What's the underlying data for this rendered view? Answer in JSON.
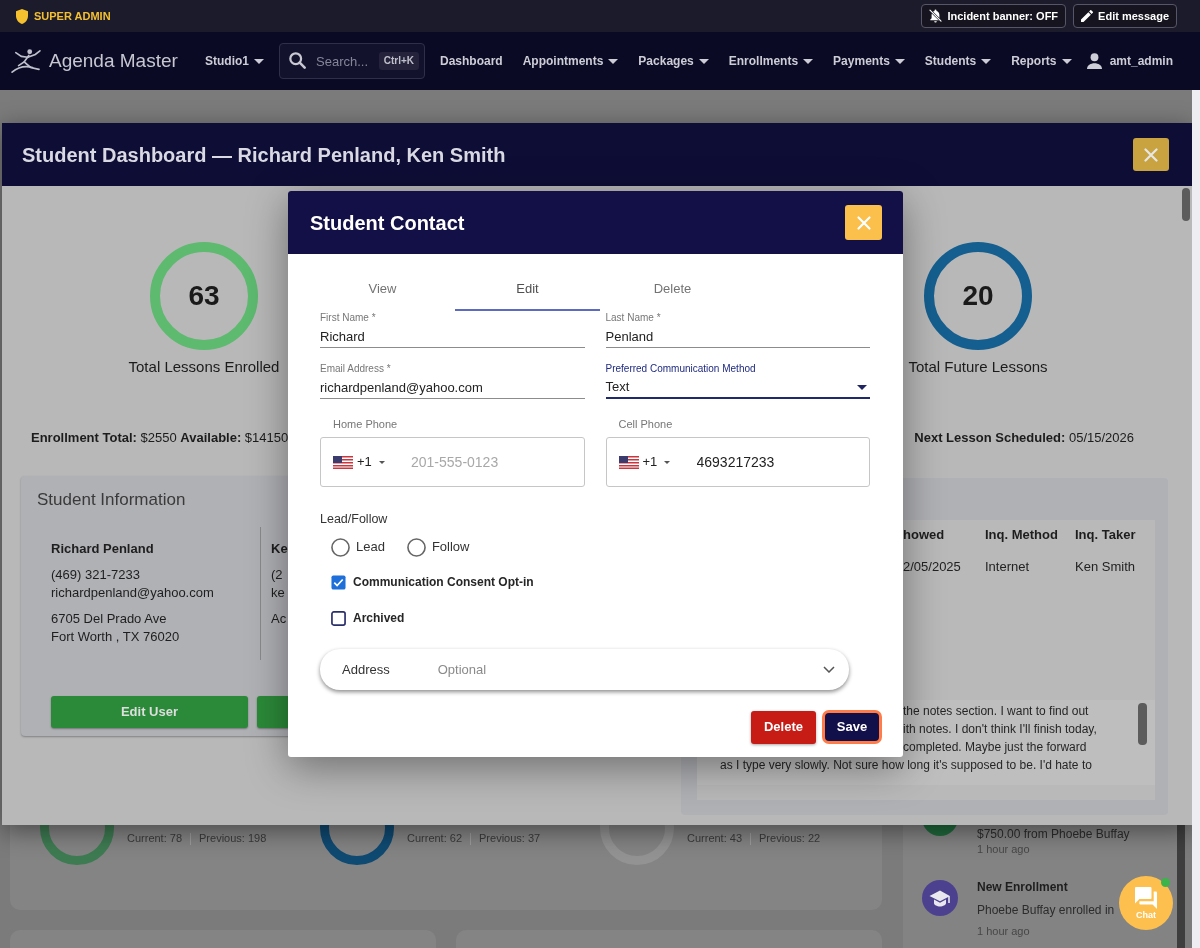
{
  "admin_bar": {
    "role": "SUPER ADMIN",
    "buttons": [
      {
        "kind": "incident",
        "label": "Incident banner: OFF"
      },
      {
        "kind": "edit",
        "label": "Edit message"
      }
    ]
  },
  "nav": {
    "brand": "Agenda Master",
    "studio": {
      "label": "Studio1",
      "dropdown": true
    },
    "search": {
      "placeholder": "Search...",
      "shortcut": "Ctrl+K"
    },
    "items": [
      {
        "label": "Dashboard",
        "dropdown": false
      },
      {
        "label": "Appointments",
        "dropdown": true
      },
      {
        "label": "Packages",
        "dropdown": true
      },
      {
        "label": "Enrollments",
        "dropdown": true
      },
      {
        "label": "Payments",
        "dropdown": true
      },
      {
        "label": "Students",
        "dropdown": true
      },
      {
        "label": "Reports",
        "dropdown": true
      }
    ],
    "user": "amt_admin"
  },
  "background_page": {
    "stats": [
      {
        "current": "Current: 78",
        "previous": "Previous: 198",
        "color": "#3e7b52"
      },
      {
        "current": "Current: 62",
        "previous": "Previous: 37",
        "color": "#0f4a72"
      },
      {
        "current": "Current: 43",
        "previous": "Previous: 22",
        "color": "#939393"
      }
    ],
    "activity": [
      {
        "kind": "payment",
        "text": "$750.00 from Phoebe Buffay",
        "time": "1 hour ago"
      },
      {
        "kind": "enrollment",
        "title": "New Enrollment",
        "text": "Phoebe Buffay enrolled in",
        "time": "1 hour ago"
      }
    ]
  },
  "dashboard_dialog": {
    "title": "Student Dashboard — Richard Penland, Ken Smith",
    "stats": [
      {
        "value": "63",
        "label": "Total Lessons Enrolled",
        "color": "#5dba6f"
      },
      {
        "value": "20",
        "label": "Total Future Lessons",
        "color": "#145f8f"
      }
    ],
    "enrollment_summary": "**Enrollment Total:** $2550 **Available:** $14150",
    "next_lesson": "**Next Lesson Scheduled:** 05/15/2026",
    "student_information": {
      "title": "Student Information",
      "students": [
        {
          "name": "Richard Penland",
          "phone": "(469) 321-7233",
          "email": "richardpenland@yahoo.com",
          "address_lines": [
            "6705 Del Prado Ave",
            "Fort Worth , TX 76020"
          ]
        },
        {
          "name": "Ke",
          "phone": "(2",
          "email": "ke",
          "address_lines": [
            "Ac"
          ]
        }
      ],
      "buttons": [
        {
          "kind": "labeled",
          "label": "Edit User"
        },
        {
          "kind": "covered"
        }
      ]
    },
    "inquiry_table": {
      "columns": [
        "howed",
        "Inq. Method",
        "Inq. Taker"
      ],
      "rows": [
        [
          "2/05/2025",
          "Internet",
          "Ken Smith"
        ]
      ]
    },
    "notes": [
      "the notes section. I want to find out",
      "ith notes. I don't think I'll finish today,",
      "completed. Maybe just the forward",
      "as I type very slowly. Not sure how long it's supposed to be. I'd hate to"
    ]
  },
  "contact_dialog": {
    "title": "Student Contact",
    "tabs": [
      {
        "label": "View",
        "selected": false
      },
      {
        "label": "Edit",
        "selected": true
      },
      {
        "label": "Delete",
        "selected": false
      }
    ],
    "fields": [
      {
        "kind": "text",
        "label": "First Name *",
        "value": "Richard",
        "focused": false
      },
      {
        "kind": "text",
        "label": "Last Name *",
        "value": "Penland",
        "focused": false
      },
      {
        "kind": "text",
        "label": "Email Address *",
        "value": "richardpenland@yahoo.com",
        "focused": false
      },
      {
        "kind": "select",
        "label": "Preferred Communication Method",
        "value": "Text",
        "focused": true
      }
    ],
    "phones": [
      {
        "label": "Home Phone",
        "country_code": "+1",
        "placeholder": "201-555-0123"
      },
      {
        "label": "Cell Phone",
        "country_code": "+1",
        "value": "4693217233"
      }
    ],
    "lead_follow": {
      "label": "Lead/Follow",
      "options": [
        {
          "label": "Lead",
          "selected": false
        },
        {
          "label": "Follow",
          "selected": false
        }
      ]
    },
    "checkboxes": [
      {
        "label": "Communication Consent Opt-in",
        "checked": true
      },
      {
        "label": "Archived",
        "checked": false
      }
    ],
    "address": {
      "label": "Address",
      "hint": "Optional",
      "expanded": false
    },
    "buttons": [
      {
        "kind": "delete",
        "label": "Delete",
        "focused": false
      },
      {
        "kind": "save",
        "label": "Save",
        "focused": true
      }
    ]
  },
  "chat": {
    "label": "Chat",
    "online": true
  }
}
